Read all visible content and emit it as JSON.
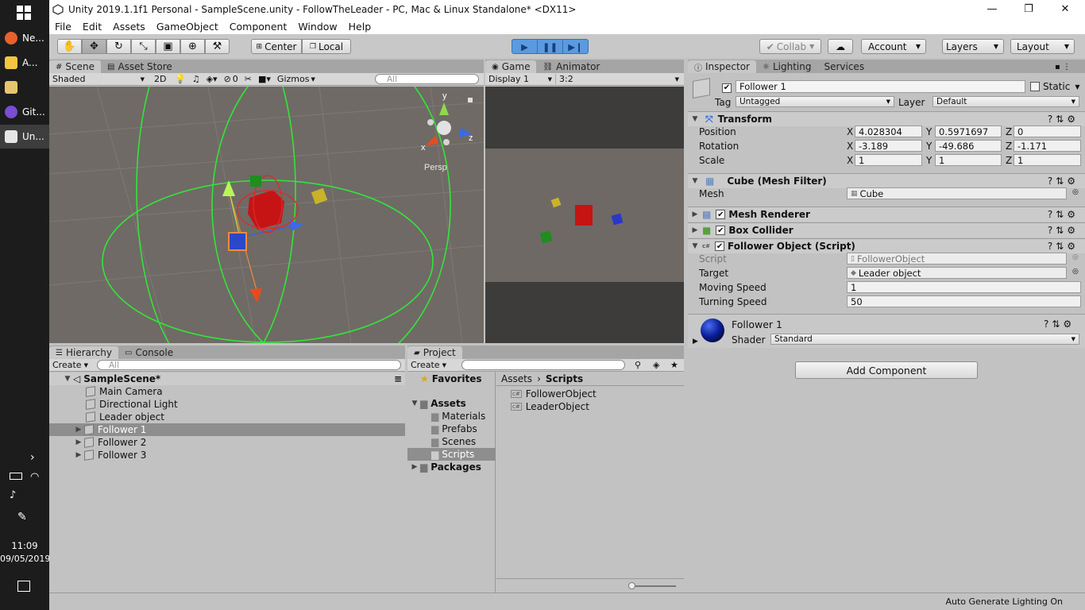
{
  "taskbar": {
    "items": [
      {
        "label": "Ne...",
        "color": "#e8612b"
      },
      {
        "label": "A...",
        "color": "#f3c540"
      },
      {
        "label": "",
        "color": "#e6c66d"
      },
      {
        "label": "Git...",
        "color": "#7a4ed1"
      },
      {
        "label": "Un...",
        "color": "#e6e6e6"
      }
    ],
    "time": "11:09",
    "date": "09/05/2019"
  },
  "window": {
    "title": "Unity 2019.1.1f1 Personal - SampleScene.unity - FollowTheLeader - PC, Mac & Linux Standalone* <DX11>"
  },
  "menu": [
    "File",
    "Edit",
    "Assets",
    "GameObject",
    "Component",
    "Window",
    "Help"
  ],
  "toolbar": {
    "pivot": "Center",
    "space": "Local",
    "collab": "Collab",
    "account": "Account",
    "layers": "Layers",
    "layout": "Layout"
  },
  "scene": {
    "tabs": [
      "Scene",
      "Asset Store"
    ],
    "shading": "Shaded",
    "mode2d": "2D",
    "hidden_count": "0",
    "gizmos": "Gizmos",
    "search_placeholder": "All",
    "persp": "Persp",
    "axis_x": "x",
    "axis_y": "y",
    "axis_z": "z"
  },
  "game": {
    "tabs": [
      "Game",
      "Animator"
    ],
    "display": "Display 1",
    "aspect": "3:2"
  },
  "hierarchy": {
    "tabs": [
      "Hierarchy",
      "Console"
    ],
    "create": "Create",
    "search_placeholder": "All",
    "scene": "SampleScene*",
    "items": [
      "Main Camera",
      "Directional Light",
      "Leader object",
      "Follower 1",
      "Follower 2",
      "Follower 3"
    ]
  },
  "project": {
    "tab": "Project",
    "create": "Create",
    "favorites": "Favorites",
    "assets": "Assets",
    "folders": [
      "Materials",
      "Prefabs",
      "Scenes",
      "Scripts"
    ],
    "packages": "Packages",
    "breadcrumb_root": "Assets",
    "breadcrumb_current": "Scripts",
    "files": [
      "FollowerObject",
      "LeaderObject"
    ]
  },
  "inspector": {
    "tabs": [
      "Inspector",
      "Lighting",
      "Services"
    ],
    "object_name": "Follower 1",
    "static_label": "Static",
    "tag_label": "Tag",
    "tag_value": "Untagged",
    "layer_label": "Layer",
    "layer_value": "Default",
    "transform": {
      "title": "Transform",
      "position_label": "Position",
      "rotation_label": "Rotation",
      "scale_label": "Scale",
      "position": {
        "x": "4.028304",
        "y": "0.5971697",
        "z": "0"
      },
      "rotation": {
        "x": "-3.189",
        "y": "-49.686",
        "z": "-1.171"
      },
      "scale": {
        "x": "1",
        "y": "1",
        "z": "1"
      }
    },
    "mesh_filter": {
      "title": "Cube (Mesh Filter)",
      "mesh_label": "Mesh",
      "mesh_value": "Cube"
    },
    "mesh_renderer": "Mesh Renderer",
    "box_collider": "Box Collider",
    "script": {
      "title": "Follower Object (Script)",
      "script_label": "Script",
      "script_value": "FollowerObject",
      "target_label": "Target",
      "target_value": "Leader object",
      "moving_speed_label": "Moving Speed",
      "moving_speed_value": "1",
      "turning_speed_label": "Turning Speed",
      "turning_speed_value": "50"
    },
    "material": {
      "name": "Follower 1",
      "shader_label": "Shader",
      "shader_value": "Standard"
    },
    "add_component": "Add Component"
  },
  "status": "Auto Generate Lighting On"
}
